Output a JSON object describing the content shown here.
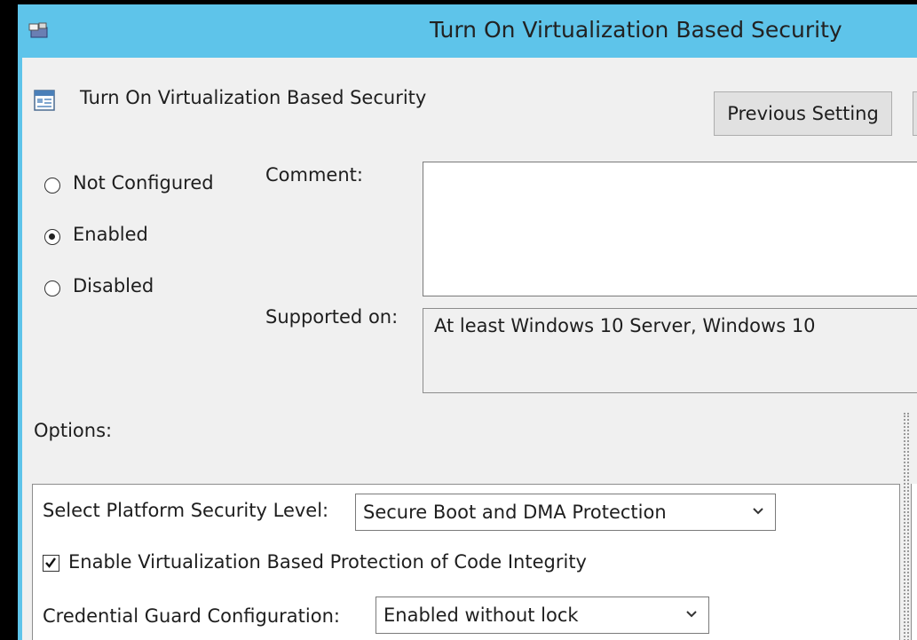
{
  "window": {
    "title": "Turn On Virtualization Based Security"
  },
  "header": {
    "policy_name": "Turn On Virtualization Based Security",
    "previous_button": "Previous Setting"
  },
  "state": {
    "options": [
      {
        "label": "Not Configured",
        "selected": false
      },
      {
        "label": "Enabled",
        "selected": true
      },
      {
        "label": "Disabled",
        "selected": false
      }
    ]
  },
  "comment": {
    "label": "Comment:",
    "value": ""
  },
  "supported": {
    "label": "Supported on:",
    "value": "At least Windows 10 Server, Windows 10"
  },
  "options": {
    "label": "Options:",
    "platform_label": "Select Platform Security Level:",
    "platform_value": "Secure Boot and DMA Protection",
    "code_integrity_label": "Enable Virtualization Based Protection of Code Integrity",
    "code_integrity_checked": true,
    "credential_guard_label": "Credential Guard Configuration:",
    "credential_guard_value": "Enabled without lock"
  },
  "colors": {
    "titlebar": "#5ec4ea",
    "client": "#f0f0f0"
  }
}
